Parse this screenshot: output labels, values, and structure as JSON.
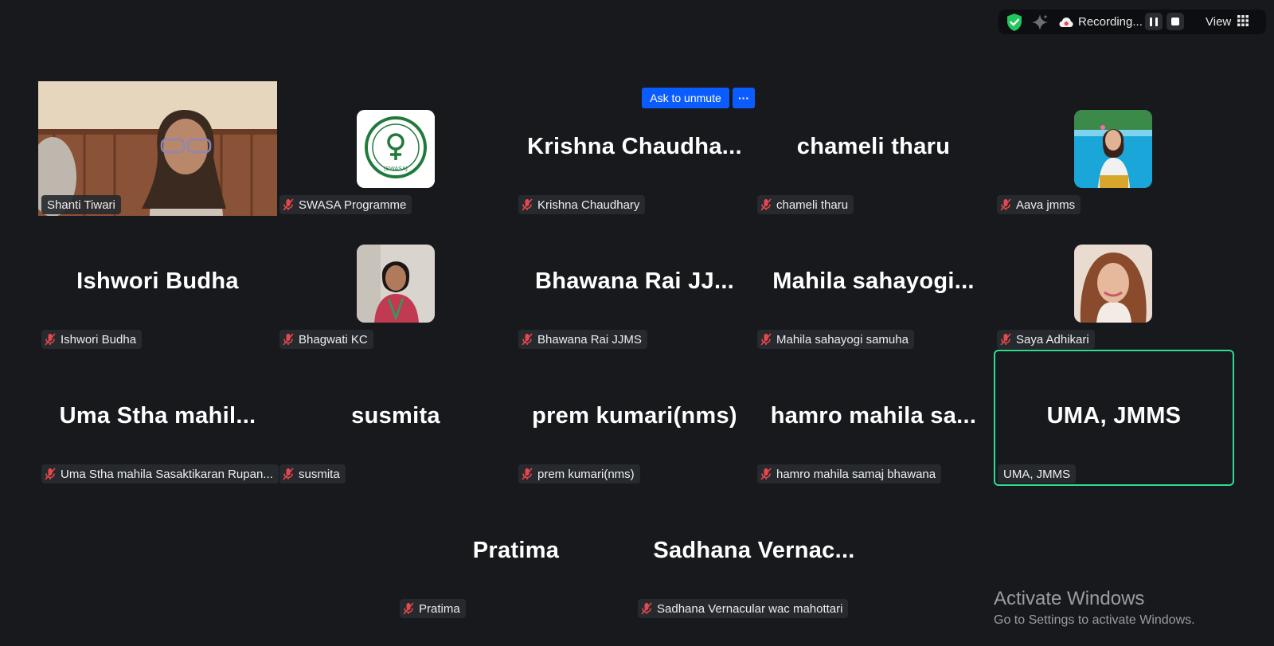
{
  "toolbar": {
    "recording_label": "Recording...",
    "view_label": "View",
    "icons": [
      "shield-check-icon",
      "sparkle-icon",
      "cloud-record-icon",
      "pause-icon",
      "stop-icon",
      "grid-icon"
    ]
  },
  "unmute": {
    "label": "Ask to unmute",
    "more_label": "···"
  },
  "participants": [
    {
      "display": "",
      "name": "Shanti Tiwari"
    },
    {
      "display": "",
      "name": "SWASA Programme"
    },
    {
      "display": "Krishna  Chaudha...",
      "name": "Krishna Chaudhary"
    },
    {
      "display": "chameli tharu",
      "name": "chameli tharu"
    },
    {
      "display": "",
      "name": "Aava jmms"
    },
    {
      "display": "Ishwori Budha",
      "name": "Ishwori Budha"
    },
    {
      "display": "",
      "name": "Bhagwati KC"
    },
    {
      "display": "Bhawana Rai   JJ...",
      "name": "Bhawana Rai  JJMS"
    },
    {
      "display": "Mahila  sahayogi...",
      "name": "Mahila sahayogi samuha"
    },
    {
      "display": "",
      "name": "Saya Adhikari"
    },
    {
      "display": "Uma  Stha  mahil...",
      "name": "Uma Stha mahila Sasaktikaran Rupan..."
    },
    {
      "display": "susmita",
      "name": "susmita"
    },
    {
      "display": "prem kumari(nms)",
      "name": "prem kumari(nms)"
    },
    {
      "display": "hamro  mahila  sa...",
      "name": "hamro mahila samaj bhawana"
    },
    {
      "display": "UMA, JMMS",
      "name": "UMA, JMMS"
    },
    {
      "display": "Pratima",
      "name": "Pratima"
    },
    {
      "display": "Sadhana  Vernac...",
      "name": "Sadhana Vernacular wac mahottari"
    }
  ],
  "logo": {
    "text": "(SWASA)"
  },
  "watermark": {
    "title": "Activate Windows",
    "subtitle": "Go to Settings to activate Windows."
  },
  "colors": {
    "background": "#17191d",
    "active_speaker_border": "#2edc8e",
    "accent_blue": "#0b5cff",
    "muted_mic": "#e5484d"
  }
}
